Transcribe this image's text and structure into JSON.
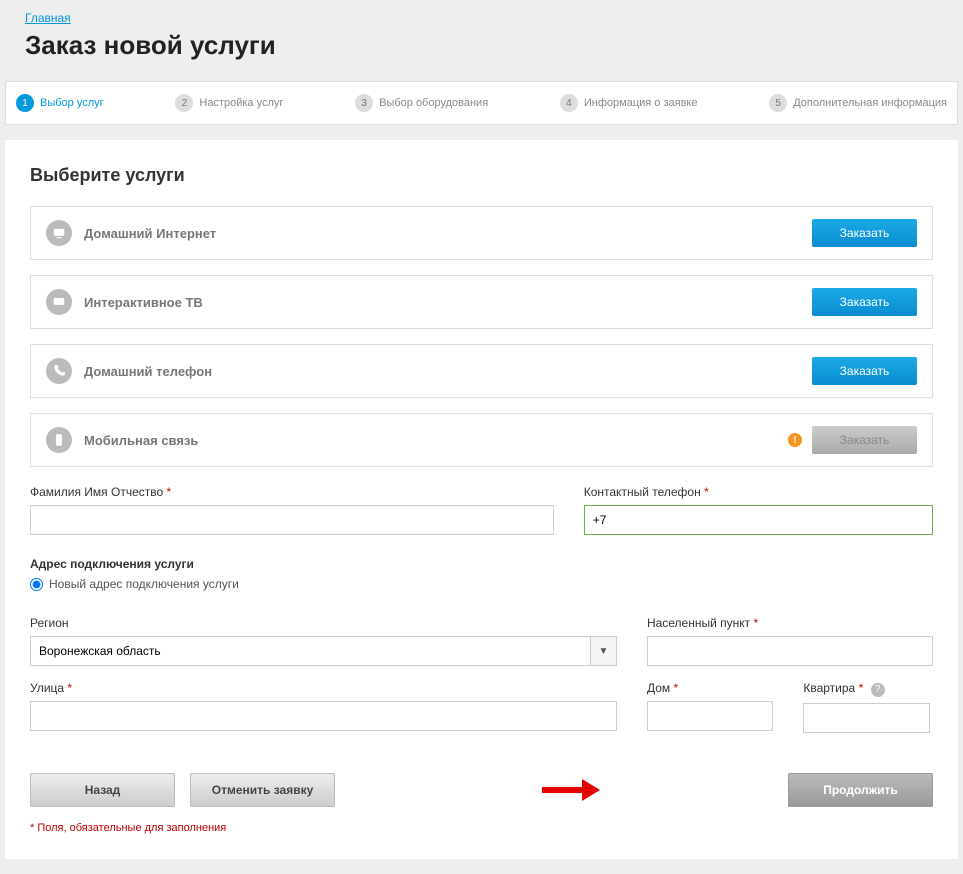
{
  "breadcrumb": "Главная",
  "page_title": "Заказ новой услуги",
  "steps": [
    {
      "num": "1",
      "label": "Выбор услуг"
    },
    {
      "num": "2",
      "label": "Настройка услуг"
    },
    {
      "num": "3",
      "label": "Выбор оборудования"
    },
    {
      "num": "4",
      "label": "Информация о заявке"
    },
    {
      "num": "5",
      "label": "Дополнительная информация"
    }
  ],
  "section_title": "Выберите услуги",
  "services": [
    {
      "name": "Домашний Интернет",
      "btn": "Заказать"
    },
    {
      "name": "Интерактивное ТВ",
      "btn": "Заказать"
    },
    {
      "name": "Домашний телефон",
      "btn": "Заказать"
    },
    {
      "name": "Мобильная связь",
      "btn": "Заказать"
    }
  ],
  "form": {
    "fio_label": "Фамилия Имя Отчество",
    "fio_value": "",
    "phone_label": "Контактный телефон",
    "phone_value": "+7",
    "address_title": "Адрес подключения услуги",
    "address_radio": "Новый адрес подключения услуги",
    "region_label": "Регион",
    "region_value": "Воронежская область",
    "city_label": "Населенный пункт",
    "city_value": "",
    "street_label": "Улица",
    "street_value": "",
    "house_label": "Дом",
    "house_value": "",
    "flat_label": "Квартира",
    "flat_value": ""
  },
  "buttons": {
    "back": "Назад",
    "cancel": "Отменить заявку",
    "continue": "Продолжить"
  },
  "footnote": "Поля, обязательные для заполнения",
  "star": "*"
}
